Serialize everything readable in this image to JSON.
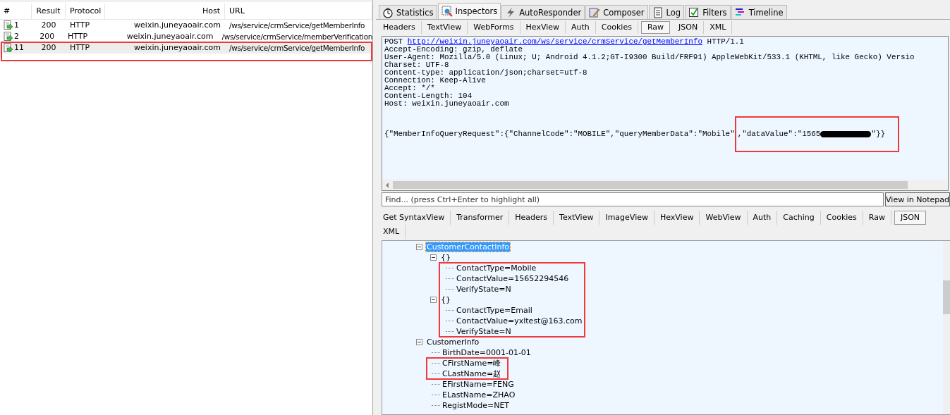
{
  "sessions": {
    "columns": [
      "#",
      "Result",
      "Protocol",
      "Host",
      "URL"
    ],
    "rows": [
      {
        "id": "1",
        "result": "200",
        "protocol": "HTTP",
        "host": "weixin.juneyaoair.com",
        "url": "/ws/service/crmService/getMemberInfo",
        "selected": false
      },
      {
        "id": "2",
        "result": "200",
        "protocol": "HTTP",
        "host": "weixin.juneyaoair.com",
        "url": "/ws/service/crmService/memberVerification",
        "selected": false
      },
      {
        "id": "11",
        "result": "200",
        "protocol": "HTTP",
        "host": "weixin.juneyaoair.com",
        "url": "/ws/service/crmService/getMemberInfo",
        "selected": true
      }
    ]
  },
  "main_tabs": [
    {
      "label": "Statistics",
      "selected": false
    },
    {
      "label": "Inspectors",
      "selected": true
    },
    {
      "label": "AutoResponder",
      "selected": false
    },
    {
      "label": "Composer",
      "selected": false
    },
    {
      "label": "Log",
      "selected": false
    },
    {
      "label": "Filters",
      "selected": false
    },
    {
      "label": "Timeline",
      "selected": false
    }
  ],
  "request_tabs": [
    {
      "label": "Headers",
      "selected": false
    },
    {
      "label": "TextView",
      "selected": false
    },
    {
      "label": "WebForms",
      "selected": false
    },
    {
      "label": "HexView",
      "selected": false
    },
    {
      "label": "Auth",
      "selected": false
    },
    {
      "label": "Cookies",
      "selected": false
    },
    {
      "label": "Raw",
      "selected": true
    },
    {
      "label": "JSON",
      "selected": false
    },
    {
      "label": "XML",
      "selected": false
    }
  ],
  "request_raw": {
    "method": "POST",
    "url": "http://weixin.juneyaoair.com/ws/service/crmService/getMemberInfo",
    "version": "HTTP/1.1",
    "headers": [
      "Accept-Encoding: gzip, deflate",
      "User-Agent: Mozilla/5.0 (Linux; U; Android 4.1.2;GT-I9300 Build/FRF91) AppleWebKit/533.1 (KHTML, like Gecko) Versio",
      "Charset: UTF-8",
      "Content-type: application/json;charset=utf-8",
      "Connection: Keep-Alive",
      "Accept: */*",
      "Content-Length: 104",
      "Host: weixin.juneyaoair.com"
    ],
    "body_before": "{\"MemberInfoQueryRequest\":{\"ChannelCode\":\"MOBILE\",\"queryMemberData\":\"Mobile\"",
    "body_middle": ",\"dataValue\":\"1565",
    "redacted": true,
    "body_after": "\"}}"
  },
  "find": {
    "placeholder": "Find... (press Ctrl+Enter to highlight all)",
    "button": "View in Notepad"
  },
  "response_tabs": [
    {
      "label": "Get SyntaxView",
      "selected": false
    },
    {
      "label": "Transformer",
      "selected": false
    },
    {
      "label": "Headers",
      "selected": false
    },
    {
      "label": "TextView",
      "selected": false
    },
    {
      "label": "ImageView",
      "selected": false
    },
    {
      "label": "HexView",
      "selected": false
    },
    {
      "label": "WebView",
      "selected": false
    },
    {
      "label": "Auth",
      "selected": false
    },
    {
      "label": "Caching",
      "selected": false
    },
    {
      "label": "Cookies",
      "selected": false
    },
    {
      "label": "Raw",
      "selected": false
    },
    {
      "label": "JSON",
      "selected": true
    },
    {
      "label": "XML",
      "selected": false
    }
  ],
  "json_tree": [
    {
      "label": "CustomerContactInfo",
      "selected": true,
      "expanded": true,
      "children": [
        {
          "label": "{}",
          "selected": false,
          "expanded": true,
          "children": [
            {
              "label": "ContactType=Mobile",
              "selected": false
            },
            {
              "label": "ContactValue=15652294546",
              "selected": false
            },
            {
              "label": "VerifyState=N",
              "selected": false
            }
          ]
        },
        {
          "label": "{}",
          "selected": false,
          "expanded": true,
          "children": [
            {
              "label": "ContactType=Email",
              "selected": false
            },
            {
              "label": "ContactValue=yxltest@163.com",
              "selected": false
            },
            {
              "label": "VerifyState=N",
              "selected": false
            }
          ]
        }
      ]
    },
    {
      "label": "CustomerInfo",
      "selected": false,
      "expanded": true,
      "children": [
        {
          "label": "BirthDate=0001-01-01",
          "selected": false
        },
        {
          "label": "CFirstName=峰",
          "selected": false
        },
        {
          "label": "CLastName=赵",
          "selected": false
        },
        {
          "label": "EFirstName=FENG",
          "selected": false
        },
        {
          "label": "ELastName=ZHAO",
          "selected": false
        },
        {
          "label": "RegistMode=NET",
          "selected": false
        }
      ]
    }
  ]
}
